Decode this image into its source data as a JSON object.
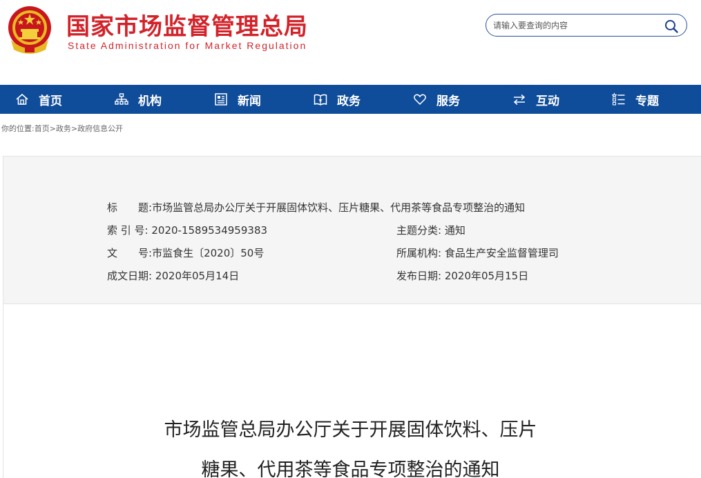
{
  "header": {
    "title_cn": "国家市场监督管理总局",
    "title_en": "State Administration for Market Regulation",
    "emblem_icon": "national-emblem-icon",
    "brand_color": "#d2232a"
  },
  "search": {
    "placeholder": "请输入要查询的内容",
    "icon": "search-icon"
  },
  "nav": {
    "background": "#0f4c99",
    "items": [
      {
        "label": "首页",
        "icon": "home-icon"
      },
      {
        "label": "机构",
        "icon": "org-chart-icon"
      },
      {
        "label": "新闻",
        "icon": "news-icon"
      },
      {
        "label": "政务",
        "icon": "government-book-icon"
      },
      {
        "label": "服务",
        "icon": "heart-icon"
      },
      {
        "label": "互动",
        "icon": "exchange-arrows-icon"
      },
      {
        "label": "专题",
        "icon": "topic-list-icon"
      }
    ]
  },
  "breadcrumb": {
    "prefix": "你的位置:",
    "items": [
      "首页",
      "政务",
      "政府信息公开"
    ],
    "separator": ">"
  },
  "info": {
    "title_label": "标　　题:",
    "title_value": "市场监管总局办公厅关于开展固体饮料、压片糖果、代用茶等食品专项整治的通知",
    "index_label": "索 引 号:",
    "index_value": "2020-1589534959383",
    "category_label": "主题分类:",
    "category_value": "通知",
    "docno_label": "文　　号:",
    "docno_value": "市监食生〔2020〕50号",
    "org_label": "所属机构:",
    "org_value": "食品生产安全监督管理司",
    "created_label": "成文日期:",
    "created_value": "2020年05月14日",
    "published_label": "发布日期:",
    "published_value": "2020年05月15日"
  },
  "document": {
    "title_line1": "市场监管总局办公厅关于开展固体饮料、压片",
    "title_line2": "糖果、代用茶等食品专项整治的通知"
  }
}
